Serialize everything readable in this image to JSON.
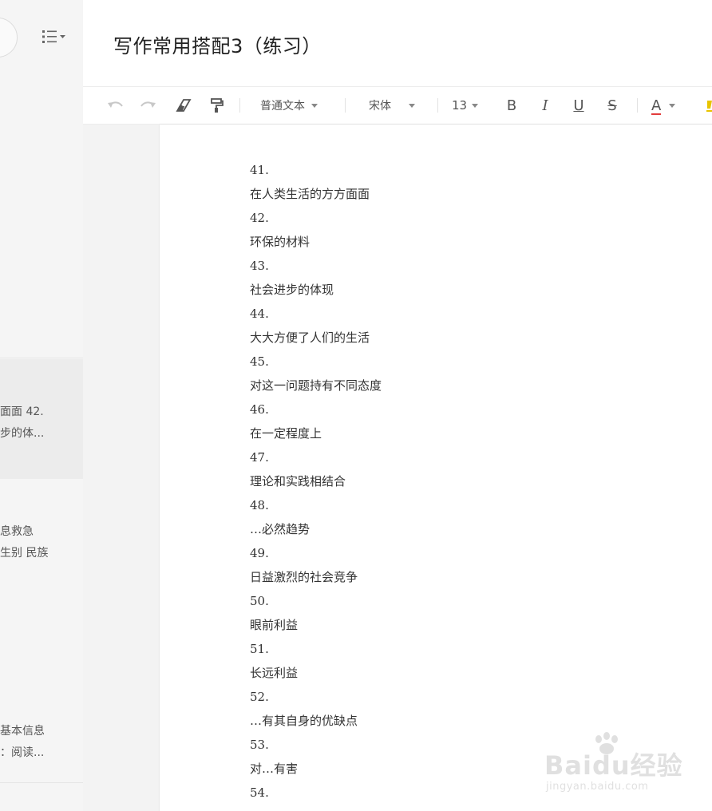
{
  "header": {
    "title": "写作常用搭配3（练习）"
  },
  "sidebar": {
    "cards": [
      {
        "line1": "面面 42.",
        "line2": "步的体..."
      },
      {
        "line1": "息救急",
        "line2": "生别 民族"
      },
      {
        "line1": "基本信息",
        "line2": "：阅读..."
      }
    ]
  },
  "toolbar": {
    "undo_icon": "undo-icon",
    "redo_icon": "redo-icon",
    "eraser_icon": "eraser-icon",
    "format_painter_icon": "format-painter-icon",
    "paragraph_style": "普通文本",
    "font_family": "宋体",
    "font_size": "13",
    "bold": "B",
    "italic": "I",
    "underline": "U",
    "strikethrough": "S",
    "font_color": "A",
    "font_color_value": "#e23c3c"
  },
  "document": {
    "lines": [
      "41.",
      "在人类生活的方方面面",
      "42.",
      "环保的材料",
      "43.",
      "社会进步的体现",
      "44.",
      "大大方便了人们的生活",
      "45.",
      "对这一问题持有不同态度",
      "46.",
      "在一定程度上",
      "47.",
      "理论和实践相结合",
      "48.",
      "…必然趋势",
      "49.",
      "日益激烈的社会竞争",
      "50.",
      "眼前利益",
      "51.",
      "长远利益",
      "52.",
      "…有其自身的优缺点",
      "53.",
      "对…有害",
      "54."
    ]
  },
  "watermark": {
    "brand": "Baidu经验",
    "url": "jingyan.baidu.com"
  }
}
